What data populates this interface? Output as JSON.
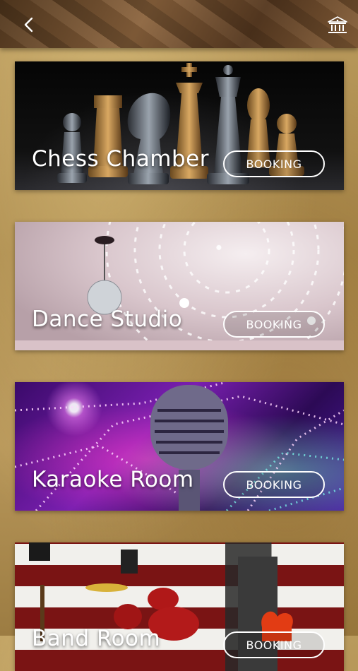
{
  "header": {
    "back_icon": "chevron-left-icon",
    "home_icon": "building-icon"
  },
  "rooms": [
    {
      "name": "Chess Chamber",
      "booking_label": "BOOKING"
    },
    {
      "name": "Dance Studio",
      "booking_label": "BOOKING"
    },
    {
      "name": "Karaoke Room",
      "booking_label": "BOOKING"
    },
    {
      "name": "Band Room",
      "booking_label": "BOOKING"
    }
  ]
}
